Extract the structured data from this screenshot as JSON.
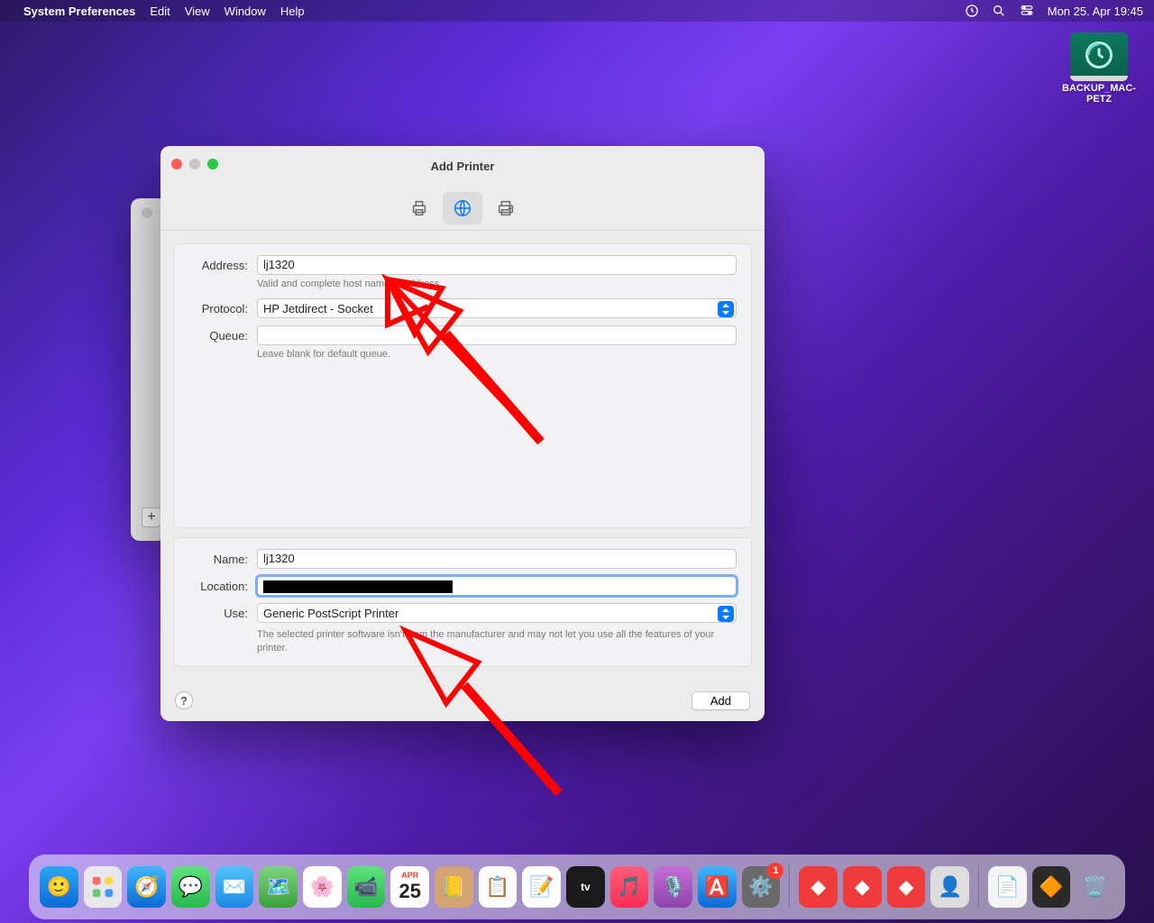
{
  "menubar": {
    "app": "System Preferences",
    "items": [
      "Edit",
      "View",
      "Window",
      "Help"
    ],
    "clock": "Mon 25. Apr  19:45"
  },
  "desktop": {
    "backup_label": "BACKUP_MAC-PETZ"
  },
  "window": {
    "title": "Add Printer",
    "tabs": {
      "default": "default-printer-icon",
      "ip": "globe-icon",
      "windows": "windows-printer-icon"
    },
    "labels": {
      "address": "Address:",
      "protocol": "Protocol:",
      "queue": "Queue:",
      "name": "Name:",
      "location": "Location:",
      "use": "Use:"
    },
    "values": {
      "address": "lj1320",
      "protocol": "HP Jetdirect - Socket",
      "queue": "",
      "name": "lj1320",
      "use": "Generic PostScript Printer"
    },
    "hints": {
      "address": "Valid and complete host name or address.",
      "queue": "Leave blank for default queue.",
      "use_warning": "The selected printer software isn't from the manufacturer and may not let you use all the features of your printer."
    },
    "buttons": {
      "add": "Add",
      "help": "?"
    }
  },
  "dock": {
    "apps": [
      "finder",
      "launchpad",
      "safari",
      "messages",
      "mail",
      "maps",
      "photos",
      "facetime",
      "calendar",
      "contacts",
      "reminders",
      "notes",
      "tv",
      "music",
      "podcasts",
      "appstore",
      "systemprefs"
    ],
    "calendar_day": "25",
    "calendar_month": "APR",
    "badge": "1",
    "extra": [
      "anydesk1",
      "anydesk2",
      "anydesk3",
      "user",
      "textedit",
      "app2",
      "trash"
    ]
  }
}
